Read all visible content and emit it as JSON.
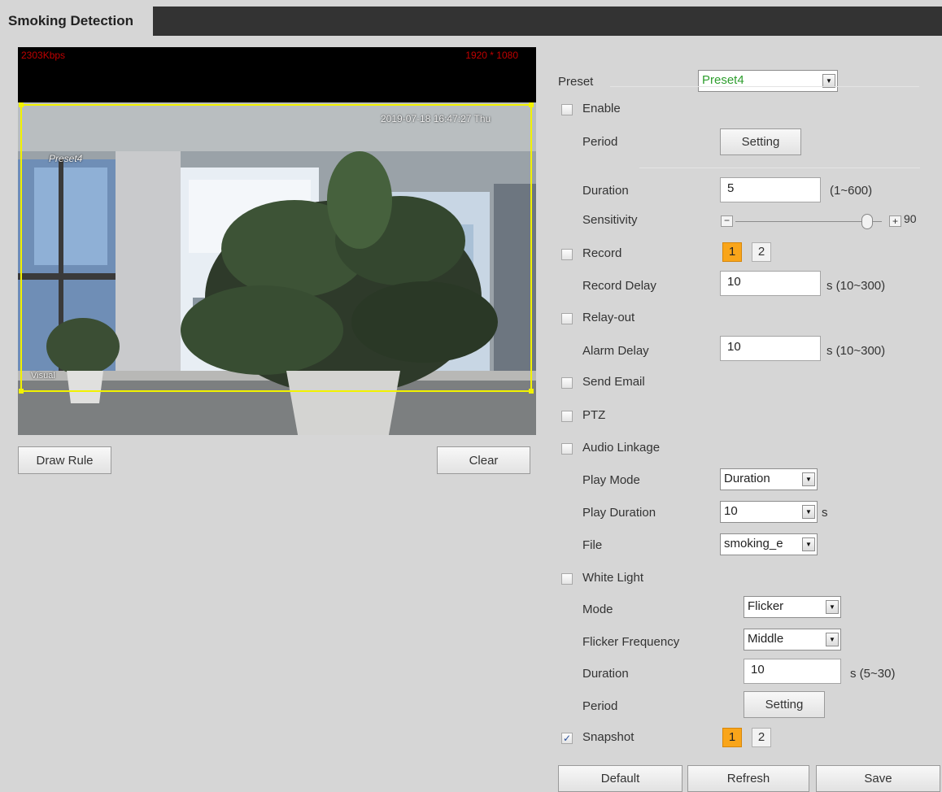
{
  "page": {
    "title": "Smoking Detection"
  },
  "video": {
    "bitrate": "2303Kbps",
    "resolution": "1920 * 1080",
    "timestamp": "2019-07-18 16:47:27 Thu",
    "preset_overlay": "Preset4",
    "channel_overlay": "Visual",
    "draw_rule_label": "Draw Rule",
    "clear_label": "Clear"
  },
  "config": {
    "preset": {
      "label": "Preset",
      "value": "Preset4",
      "value_color": "#2e9e2e"
    },
    "enable": {
      "label": "Enable",
      "checked": false
    },
    "period": {
      "label": "Period",
      "button": "Setting"
    },
    "duration": {
      "label": "Duration",
      "value": "5",
      "range": "(1~600)"
    },
    "sensitivity": {
      "label": "Sensitivity",
      "value": "90",
      "level": 0.9
    },
    "record": {
      "label": "Record",
      "checked": false,
      "channels": [
        "1",
        "2"
      ],
      "active_channel": "1"
    },
    "record_delay": {
      "label": "Record Delay",
      "value": "10",
      "range": "s (10~300)"
    },
    "relay_out": {
      "label": "Relay-out",
      "checked": false
    },
    "alarm_delay": {
      "label": "Alarm Delay",
      "value": "10",
      "range": "s (10~300)"
    },
    "send_email": {
      "label": "Send Email",
      "checked": false
    },
    "ptz": {
      "label": "PTZ",
      "checked": false
    },
    "audio_linkage": {
      "label": "Audio Linkage",
      "checked": false
    },
    "play_mode": {
      "label": "Play Mode",
      "value": "Duration"
    },
    "play_duration": {
      "label": "Play Duration",
      "value": "10",
      "unit": "s"
    },
    "file": {
      "label": "File",
      "value": "smoking_e"
    },
    "white_light": {
      "label": "White Light",
      "checked": false
    },
    "mode": {
      "label": "Mode",
      "value": "Flicker"
    },
    "flicker_frequency": {
      "label": "Flicker Frequency",
      "value": "Middle"
    },
    "wl_duration": {
      "label": "Duration",
      "value": "10",
      "range": "s (5~30)"
    },
    "wl_period": {
      "label": "Period",
      "button": "Setting"
    },
    "snapshot": {
      "label": "Snapshot",
      "checked": true,
      "check_glyph": "✓",
      "channels": [
        "1",
        "2"
      ],
      "active_channel": "1"
    }
  },
  "footer": {
    "default_label": "Default",
    "refresh_label": "Refresh",
    "save_label": "Save"
  },
  "colors": {
    "accent_orange": "#f9a51a",
    "rule_yellow": "#f2f200",
    "osd_red": "#c00000"
  }
}
